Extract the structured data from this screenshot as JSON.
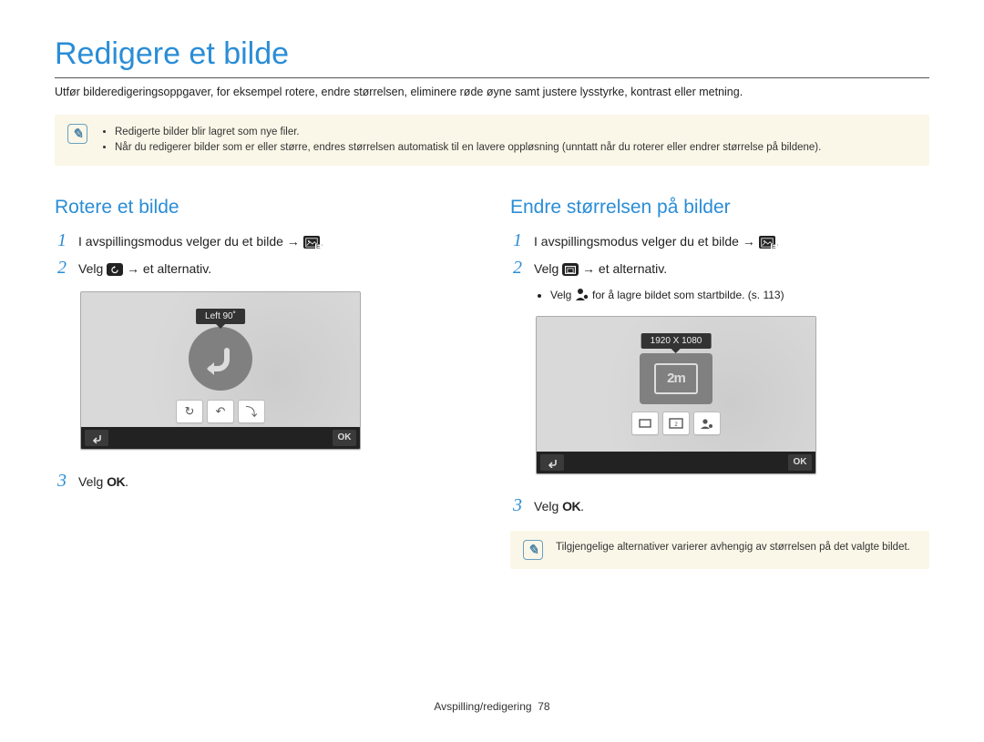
{
  "title": "Redigere et bilde",
  "intro": "Utfør bilderedigeringsoppgaver, for eksempel rotere, endre størrelsen, eliminere røde øyne samt justere lysstyrke, kontrast eller metning.",
  "note_box": {
    "items": [
      "Redigerte bilder blir lagret som nye filer.",
      "Når du redigerer bilder som er      eller større, endres størrelsen automatisk til en lavere oppløsning (unntatt når du roterer eller endrer størrelse på bildene)."
    ]
  },
  "left": {
    "section_title": "Rotere et bilde",
    "steps": {
      "1": "I avspillingsmodus velger du et bilde →",
      "2_pre": "Velg",
      "2_post": "→ et alternativ.",
      "3_pre": "Velg",
      "3_ok": "OK"
    },
    "screen": {
      "tooltip": "Left 90˚",
      "ok": "OK"
    }
  },
  "right": {
    "section_title": "Endre størrelsen på bilder",
    "steps": {
      "1": "I avspillingsmodus velger du et bilde →",
      "2_pre": "Velg",
      "2_post": "→ et alternativ.",
      "2_bullet_pre": "Velg",
      "2_bullet_post": "for å lagre bildet som startbilde. (s. 113)",
      "3_pre": "Velg",
      "3_ok": "OK"
    },
    "screen": {
      "tooltip": "1920 X 1080",
      "size_label": "2m",
      "ok": "OK"
    },
    "bottom_note": "Tilgjengelige alternativer varierer avhengig av størrelsen på det valgte bildet."
  },
  "footer": {
    "section": "Avspilling/redigering",
    "page": "78"
  },
  "period": "."
}
